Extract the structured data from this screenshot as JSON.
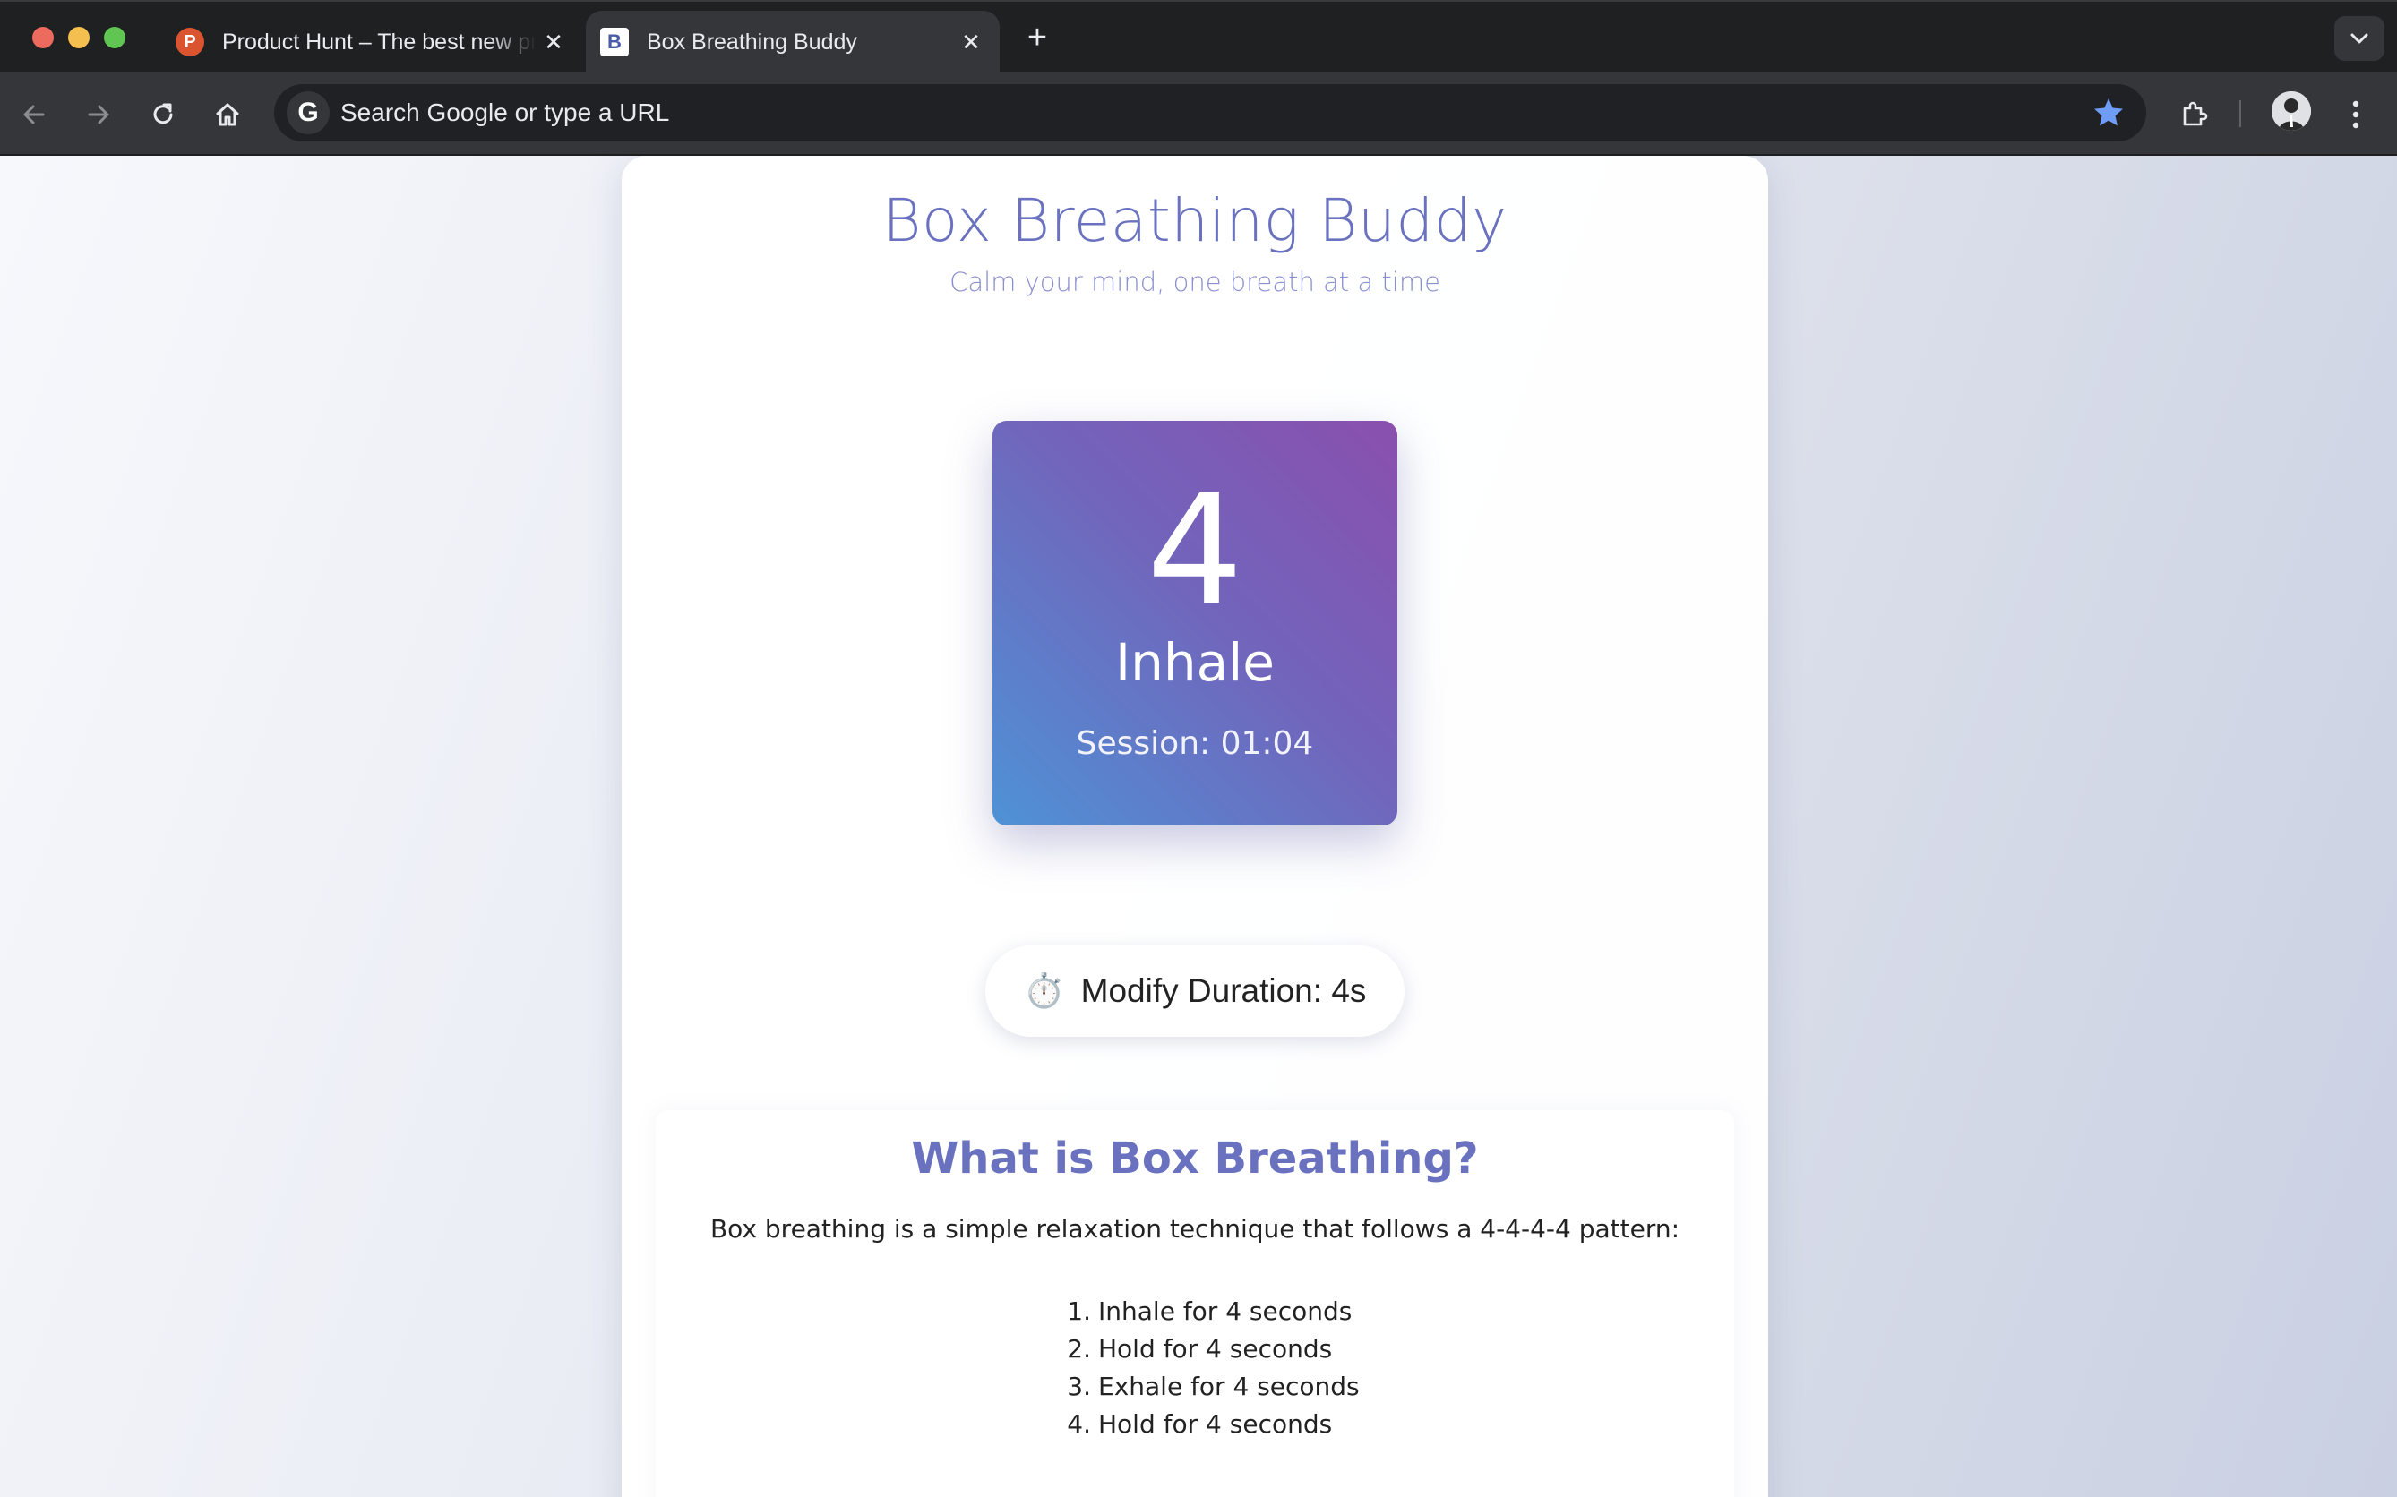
{
  "browser": {
    "tabs": [
      {
        "favicon_letter": "P",
        "title": "Product Hunt – The best new products in tech."
      },
      {
        "favicon_letter": "B",
        "title": "Box Breathing Buddy"
      }
    ],
    "omnibox": {
      "text": "Search Google or type a URL",
      "google_letter": "G"
    }
  },
  "app": {
    "title": "Box Breathing Buddy",
    "subtitle": "Calm your mind, one breath at a time",
    "count": "4",
    "phase": "Inhale",
    "session": "Session: 01:04",
    "duration_icon": "⏱️",
    "duration_label": "Modify Duration: 4s"
  },
  "info": {
    "title": "What is Box Breathing?",
    "text": "Box breathing is a simple relaxation technique that follows a 4-4-4-4 pattern:",
    "steps": [
      {
        "num": "1.",
        "text": "Inhale for 4 seconds"
      },
      {
        "num": "2.",
        "text": "Hold for 4 seconds"
      },
      {
        "num": "3.",
        "text": "Exhale for 4 seconds"
      },
      {
        "num": "4.",
        "text": "Hold for 4 seconds"
      }
    ]
  },
  "colors": {
    "accent": "#6a72c0",
    "box_gradient_start": "#8a4fae",
    "box_gradient_end": "#4e92d6",
    "star": "#6f9cf5"
  }
}
